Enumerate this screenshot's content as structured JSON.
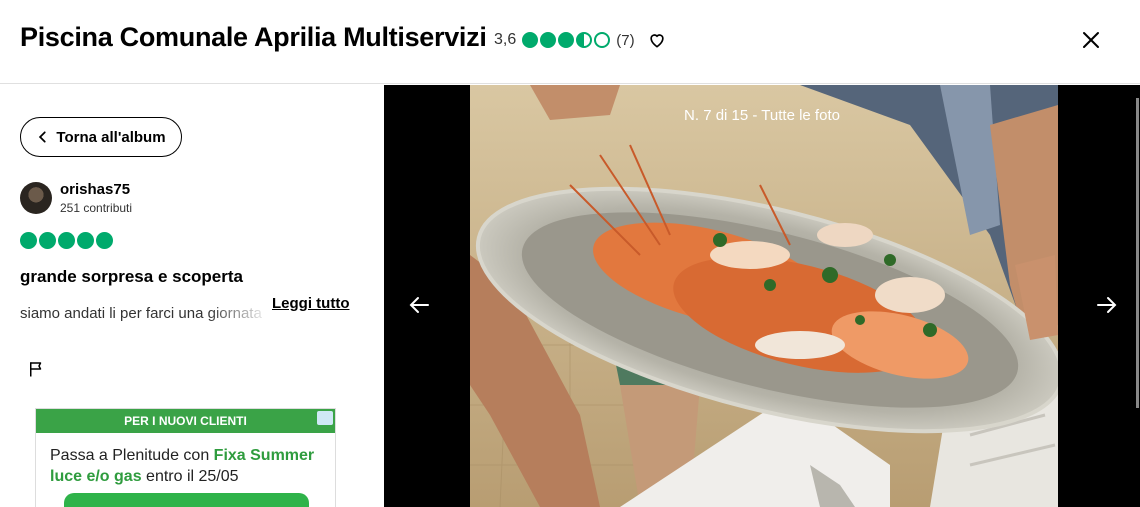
{
  "header": {
    "title": "Piscina Comunale Aprilia Multiservizi",
    "rating": "3,6",
    "rating_value": 3.5,
    "review_count": "(7)",
    "heart_icon": "heart-icon",
    "close_icon": "close-icon"
  },
  "sidebar": {
    "back_label": "Torna all'album",
    "username": "orishas75",
    "contributions": "251 contributi",
    "review_rating": 5,
    "review_title": "grande sorpresa e scoperta",
    "review_text": "siamo andati li per farci una giornata",
    "read_more": "Leggi tutto",
    "flag_icon": "flag-icon"
  },
  "ad": {
    "banner": "PER I NUOVI CLIENTI",
    "text_1": "Passa a Plenitude con ",
    "text_highlight_1": "Fixa Summer",
    "text_highlight_2": "luce e/o gas",
    "text_2": " entro il 25/05"
  },
  "viewer": {
    "counter": "N. 7 di 15 - Tutte le foto",
    "prev_icon": "arrow-left-icon",
    "next_icon": "arrow-right-icon"
  },
  "colors": {
    "brand_green": "#00aa6c",
    "ad_green": "#3aa347"
  }
}
